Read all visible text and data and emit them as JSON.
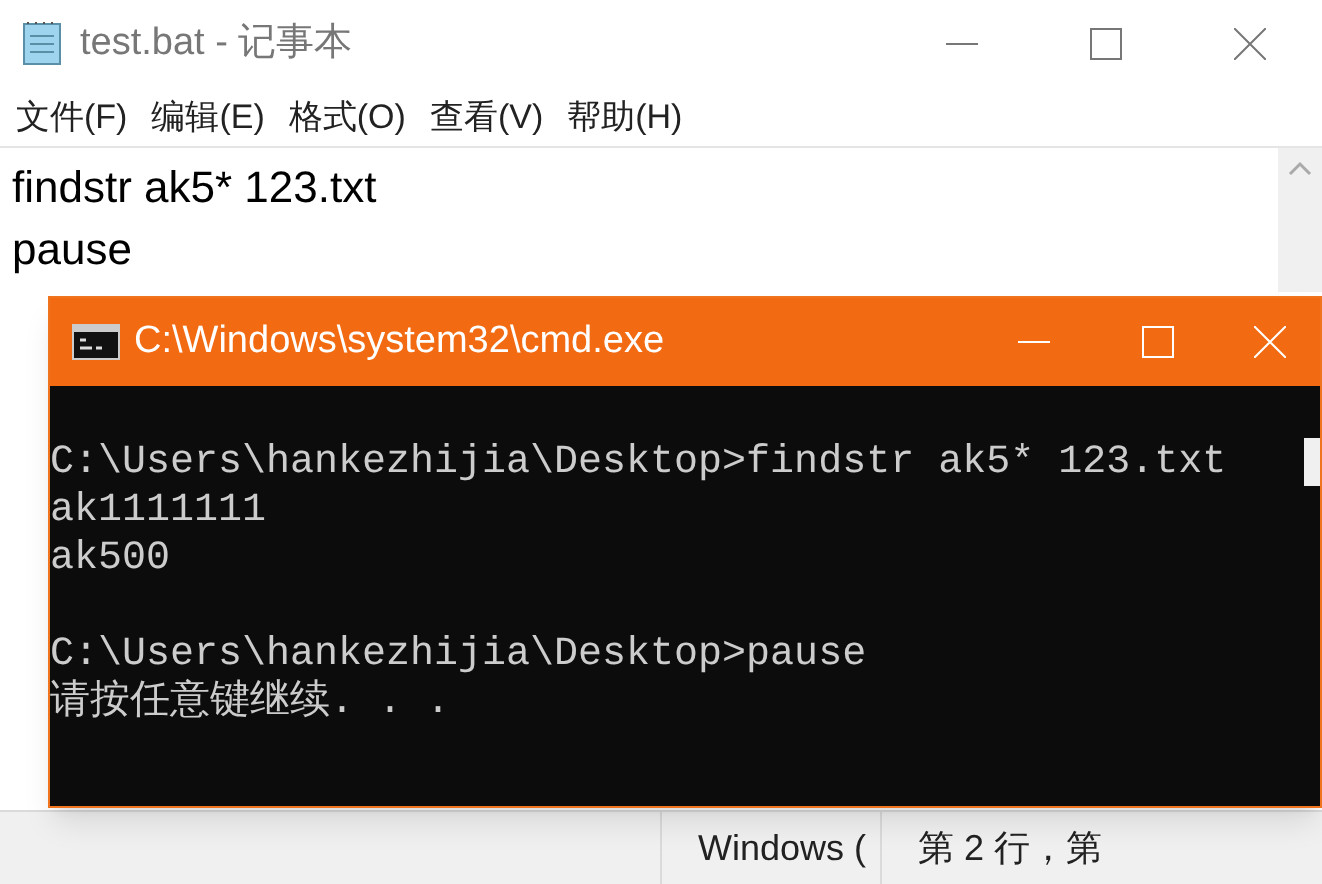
{
  "notepad": {
    "title": "test.bat - 记事本",
    "menu": [
      "文件(F)",
      "编辑(E)",
      "格式(O)",
      "查看(V)",
      "帮助(H)"
    ],
    "lines": [
      "findstr ak5* 123.txt",
      "pause"
    ],
    "status_bar": [
      "Windows (",
      "第 2 行，第"
    ]
  },
  "console": {
    "title": "C:\\Windows\\system32\\cmd.exe",
    "blocks": [
      {
        "lines": [
          "C:\\Users\\hankezhijia\\Desktop>findstr ak5* 123.txt",
          "ak1111111",
          "ak500"
        ]
      },
      {
        "lines": [
          "C:\\Users\\hankezhijia\\Desktop>pause",
          "请按任意键继续. . ."
        ]
      }
    ]
  }
}
